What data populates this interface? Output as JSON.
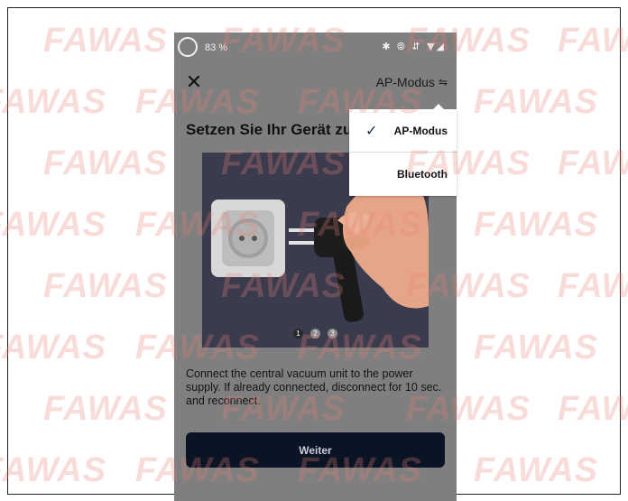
{
  "status_bar": {
    "battery": "83 %",
    "icons": "✱ ⦾ ⇵ ▼◢"
  },
  "header": {
    "close_icon": "close-icon",
    "mode_label": "AP-Modus",
    "mode_icon": "⇋"
  },
  "title": "Setzen Sie Ihr Gerät zu",
  "illustration": {
    "pagination": [
      "1",
      "2",
      "3"
    ],
    "active_index": 0
  },
  "description": "Connect the central vacuum unit to the power supply. If already connected, disconnect for 10 sec. and reconnect.",
  "primary_button": "Weiter",
  "mode_menu": {
    "items": [
      {
        "label": "AP-Modus",
        "selected": true
      },
      {
        "label": "Bluetooth",
        "selected": false
      }
    ],
    "check_icon": "✓"
  },
  "watermark": "FAWAS",
  "colors": {
    "overlay": "#7f7f7f",
    "button_bg": "#0b1424",
    "illustration_bg": "#3b3b4e"
  }
}
